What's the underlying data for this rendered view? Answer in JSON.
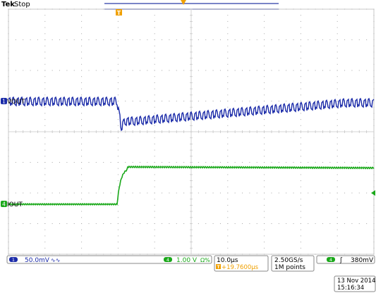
{
  "header": {
    "brand": "Tek",
    "run_state": "Stop"
  },
  "markers": {
    "trigger_pos": "T",
    "ch1_ref": "1",
    "ch4_ref": "4",
    "ch1_label": "VOUT",
    "ch4_label": "IOUT"
  },
  "channels": {
    "ch1": {
      "number": "1",
      "scale": "50.0mV",
      "coupling_symbol": "∿∿",
      "color": "#1a2aa8"
    },
    "ch4": {
      "number": "4",
      "scale": "1.00 V",
      "impedance": "Ω%",
      "color": "#1aa81a"
    }
  },
  "horizontal": {
    "time_div": "10.0µs",
    "trigger_offset_icon": "T",
    "trigger_offset": "+19.7600µs"
  },
  "acquisition": {
    "sample_rate": "2.50GS/s",
    "record_length": "1M points"
  },
  "trigger": {
    "source": "4",
    "slope_symbol": "ʃ",
    "level": "380mV"
  },
  "datetime": {
    "date": "13 Nov 2014",
    "time": "15:16:34"
  },
  "colors": {
    "grid": "#a8a8a8",
    "vout_trace": "#1a2aa8",
    "iout_trace": "#1aa81a",
    "trigger_marker": "#f0a000",
    "status_border": "#888888"
  }
}
